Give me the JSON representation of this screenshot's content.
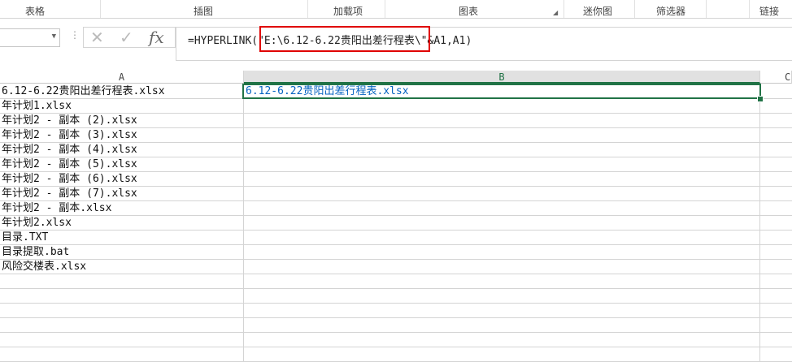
{
  "ribbon": {
    "groups": [
      "表格",
      "插图",
      "加载项",
      "图表",
      "迷你图",
      "筛选器",
      "链接"
    ]
  },
  "formula_bar": {
    "cancel": "✕",
    "enter": "✓",
    "fx": "fx",
    "formula": "=HYPERLINK(\"E:\\6.12-6.22贵阳出差行程表\\\"&A1,A1)"
  },
  "columns": [
    "A",
    "B",
    "C"
  ],
  "rows": [
    {
      "a": "6.12-6.22贵阳出差行程表.xlsx",
      "b": "6.12-6.22贵阳出差行程表.xlsx"
    },
    {
      "a": "年计划1.xlsx"
    },
    {
      "a": "年计划2 - 副本 (2).xlsx"
    },
    {
      "a": "年计划2 - 副本 (3).xlsx"
    },
    {
      "a": "年计划2 - 副本 (4).xlsx"
    },
    {
      "a": "年计划2 - 副本 (5).xlsx"
    },
    {
      "a": "年计划2 - 副本 (6).xlsx"
    },
    {
      "a": "年计划2 - 副本 (7).xlsx"
    },
    {
      "a": "年计划2 - 副本.xlsx"
    },
    {
      "a": "年计划2.xlsx"
    },
    {
      "a": "目录.TXT"
    },
    {
      "a": "目录提取.bat"
    },
    {
      "a": "风险交楼表.xlsx"
    },
    {},
    {},
    {},
    {},
    {},
    {}
  ]
}
